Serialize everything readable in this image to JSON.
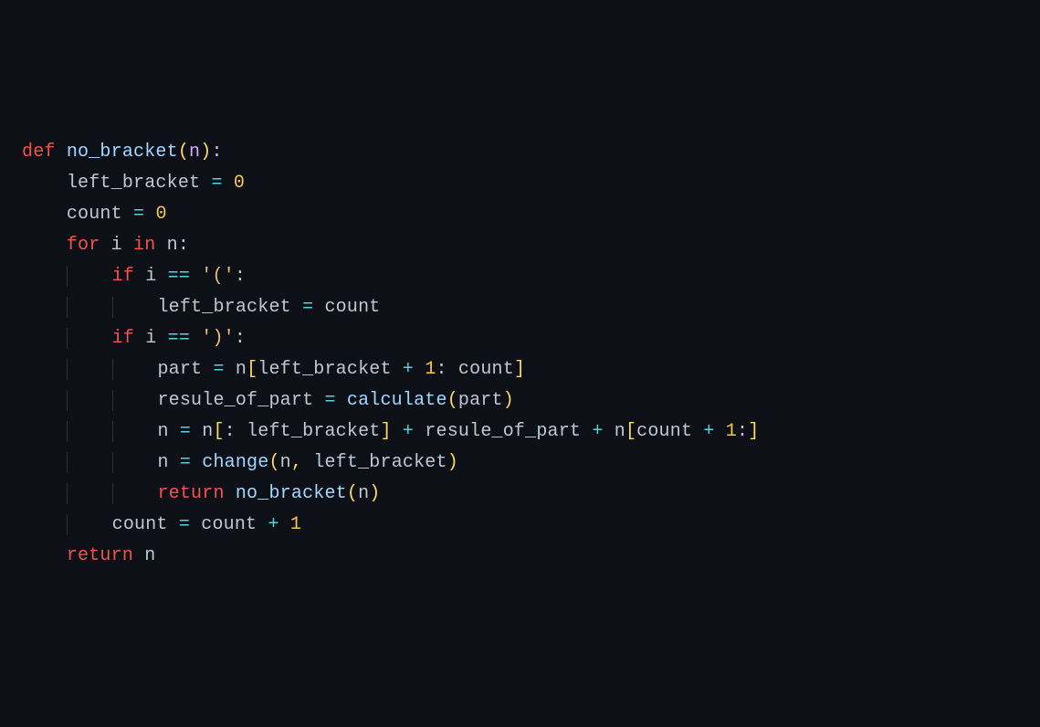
{
  "code": {
    "lines": [
      {
        "indent": 0,
        "tokens": [
          {
            "cls": "tok-kw",
            "t": "def "
          },
          {
            "cls": "tok-fn",
            "t": "no_bracket"
          },
          {
            "cls": "tok-paren",
            "t": "("
          },
          {
            "cls": "tok-param",
            "t": "n"
          },
          {
            "cls": "tok-paren",
            "t": ")"
          },
          {
            "cls": "tok-colon",
            "t": ":"
          }
        ]
      },
      {
        "indent": 1,
        "tokens": [
          {
            "cls": "tok-id",
            "t": "left_bracket "
          },
          {
            "cls": "tok-op",
            "t": "="
          },
          {
            "cls": "tok-id",
            "t": " "
          },
          {
            "cls": "tok-num",
            "t": "0"
          }
        ]
      },
      {
        "indent": 1,
        "tokens": [
          {
            "cls": "tok-id",
            "t": "count "
          },
          {
            "cls": "tok-op",
            "t": "="
          },
          {
            "cls": "tok-id",
            "t": " "
          },
          {
            "cls": "tok-num",
            "t": "0"
          }
        ]
      },
      {
        "indent": 1,
        "tokens": [
          {
            "cls": "tok-kw",
            "t": "for"
          },
          {
            "cls": "tok-id",
            "t": " i "
          },
          {
            "cls": "tok-kw",
            "t": "in"
          },
          {
            "cls": "tok-id",
            "t": " n"
          },
          {
            "cls": "tok-colon",
            "t": ":"
          }
        ]
      },
      {
        "indent": 2,
        "tokens": [
          {
            "cls": "tok-kw",
            "t": "if"
          },
          {
            "cls": "tok-id",
            "t": " i "
          },
          {
            "cls": "tok-cmp",
            "t": "=="
          },
          {
            "cls": "tok-id",
            "t": " "
          },
          {
            "cls": "tok-str",
            "t": "'('"
          },
          {
            "cls": "tok-colon",
            "t": ":"
          }
        ]
      },
      {
        "indent": 3,
        "tokens": [
          {
            "cls": "tok-id",
            "t": "left_bracket "
          },
          {
            "cls": "tok-op",
            "t": "="
          },
          {
            "cls": "tok-id",
            "t": " count"
          }
        ]
      },
      {
        "indent": 2,
        "tokens": [
          {
            "cls": "tok-kw",
            "t": "if"
          },
          {
            "cls": "tok-id",
            "t": " i "
          },
          {
            "cls": "tok-cmp",
            "t": "=="
          },
          {
            "cls": "tok-id",
            "t": " "
          },
          {
            "cls": "tok-str",
            "t": "')'"
          },
          {
            "cls": "tok-colon",
            "t": ":"
          }
        ]
      },
      {
        "indent": 3,
        "tokens": [
          {
            "cls": "tok-id",
            "t": "part "
          },
          {
            "cls": "tok-op",
            "t": "="
          },
          {
            "cls": "tok-id",
            "t": " n"
          },
          {
            "cls": "tok-paren",
            "t": "["
          },
          {
            "cls": "tok-id",
            "t": "left_bracket "
          },
          {
            "cls": "tok-op",
            "t": "+"
          },
          {
            "cls": "tok-id",
            "t": " "
          },
          {
            "cls": "tok-num",
            "t": "1"
          },
          {
            "cls": "tok-colon",
            "t": ": "
          },
          {
            "cls": "tok-id",
            "t": "count"
          },
          {
            "cls": "tok-paren",
            "t": "]"
          }
        ]
      },
      {
        "indent": 3,
        "tokens": [
          {
            "cls": "tok-id",
            "t": "resule_of_part "
          },
          {
            "cls": "tok-op",
            "t": "="
          },
          {
            "cls": "tok-id",
            "t": " "
          },
          {
            "cls": "tok-fn",
            "t": "calculate"
          },
          {
            "cls": "tok-paren",
            "t": "("
          },
          {
            "cls": "tok-id",
            "t": "part"
          },
          {
            "cls": "tok-paren",
            "t": ")"
          }
        ]
      },
      {
        "indent": 3,
        "tokens": [
          {
            "cls": "tok-id",
            "t": "n "
          },
          {
            "cls": "tok-op",
            "t": "="
          },
          {
            "cls": "tok-id",
            "t": " n"
          },
          {
            "cls": "tok-paren",
            "t": "["
          },
          {
            "cls": "tok-colon",
            "t": ": "
          },
          {
            "cls": "tok-id",
            "t": "left_bracket"
          },
          {
            "cls": "tok-paren",
            "t": "]"
          },
          {
            "cls": "tok-id",
            "t": " "
          },
          {
            "cls": "tok-op",
            "t": "+"
          },
          {
            "cls": "tok-id",
            "t": " resule_of_part "
          },
          {
            "cls": "tok-op",
            "t": "+"
          },
          {
            "cls": "tok-id",
            "t": " n"
          },
          {
            "cls": "tok-paren",
            "t": "["
          },
          {
            "cls": "tok-id",
            "t": "count "
          },
          {
            "cls": "tok-op",
            "t": "+"
          },
          {
            "cls": "tok-id",
            "t": " "
          },
          {
            "cls": "tok-num",
            "t": "1"
          },
          {
            "cls": "tok-colon",
            "t": ":"
          },
          {
            "cls": "tok-paren",
            "t": "]"
          }
        ]
      },
      {
        "indent": 3,
        "tokens": [
          {
            "cls": "tok-id",
            "t": "n "
          },
          {
            "cls": "tok-op",
            "t": "="
          },
          {
            "cls": "tok-id",
            "t": " "
          },
          {
            "cls": "tok-fn",
            "t": "change"
          },
          {
            "cls": "tok-paren",
            "t": "("
          },
          {
            "cls": "tok-id",
            "t": "n"
          },
          {
            "cls": "tok-punc",
            "t": ","
          },
          {
            "cls": "tok-id",
            "t": " left_bracket"
          },
          {
            "cls": "tok-paren",
            "t": ")"
          }
        ]
      },
      {
        "indent": 3,
        "tokens": [
          {
            "cls": "tok-kw",
            "t": "return"
          },
          {
            "cls": "tok-id",
            "t": " "
          },
          {
            "cls": "tok-fn",
            "t": "no_bracket"
          },
          {
            "cls": "tok-paren",
            "t": "("
          },
          {
            "cls": "tok-id",
            "t": "n"
          },
          {
            "cls": "tok-paren",
            "t": ")"
          }
        ]
      },
      {
        "indent": 2,
        "tokens": [
          {
            "cls": "tok-id",
            "t": "count "
          },
          {
            "cls": "tok-op",
            "t": "="
          },
          {
            "cls": "tok-id",
            "t": " count "
          },
          {
            "cls": "tok-op",
            "t": "+"
          },
          {
            "cls": "tok-id",
            "t": " "
          },
          {
            "cls": "tok-num",
            "t": "1"
          }
        ]
      },
      {
        "indent": 1,
        "tokens": [
          {
            "cls": "tok-kw",
            "t": "return"
          },
          {
            "cls": "tok-id",
            "t": " n"
          }
        ]
      }
    ]
  }
}
